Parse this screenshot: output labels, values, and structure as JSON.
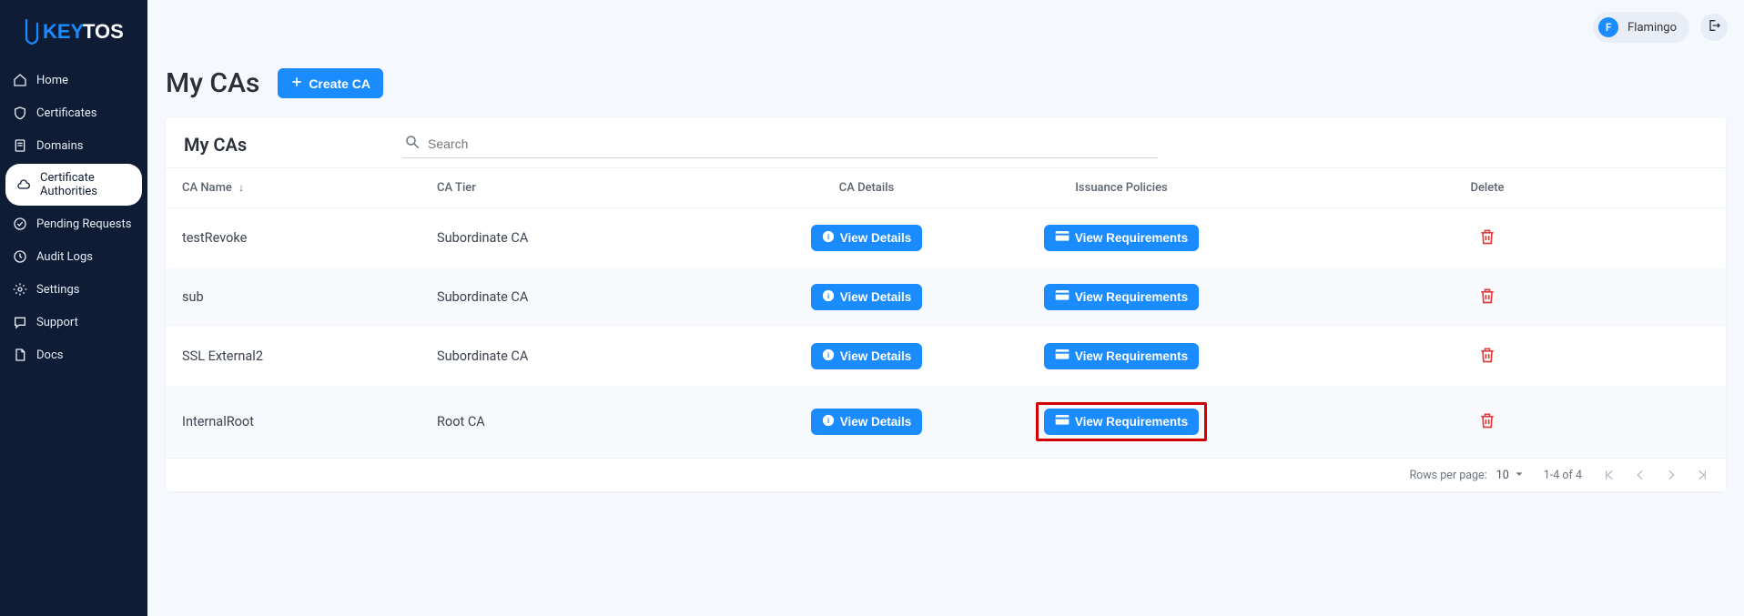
{
  "brand": {
    "key": "KEY",
    "tos": "TOS"
  },
  "user": {
    "initial": "F",
    "name": "Flamingo"
  },
  "sidebar": {
    "items": [
      {
        "label": "Home"
      },
      {
        "label": "Certificates"
      },
      {
        "label": "Domains"
      },
      {
        "label": "Certificate Authorities"
      },
      {
        "label": "Pending Requests"
      },
      {
        "label": "Audit Logs"
      },
      {
        "label": "Settings"
      },
      {
        "label": "Support"
      },
      {
        "label": "Docs"
      }
    ],
    "active_index": 3
  },
  "page": {
    "title": "My CAs",
    "create_button": "Create CA"
  },
  "card": {
    "title": "My CAs",
    "search_placeholder": "Search"
  },
  "table": {
    "columns": {
      "name": "CA Name",
      "tier": "CA Tier",
      "details": "CA Details",
      "policies": "Issuance Policies",
      "delete": "Delete"
    },
    "sort_column": "name",
    "sort_dir": "desc",
    "buttons": {
      "view_details": "View Details",
      "view_requirements": "View Requirements"
    },
    "rows": [
      {
        "name": "testRevoke",
        "tier": "Subordinate CA",
        "highlight_policies": false
      },
      {
        "name": "sub",
        "tier": "Subordinate CA",
        "highlight_policies": false
      },
      {
        "name": "SSL External2",
        "tier": "Subordinate CA",
        "highlight_policies": false
      },
      {
        "name": "InternalRoot",
        "tier": "Root CA",
        "highlight_policies": true
      }
    ]
  },
  "pagination": {
    "rows_per_page_label": "Rows per page:",
    "rows_per_page_value": "10",
    "range_label": "1-4 of 4"
  }
}
